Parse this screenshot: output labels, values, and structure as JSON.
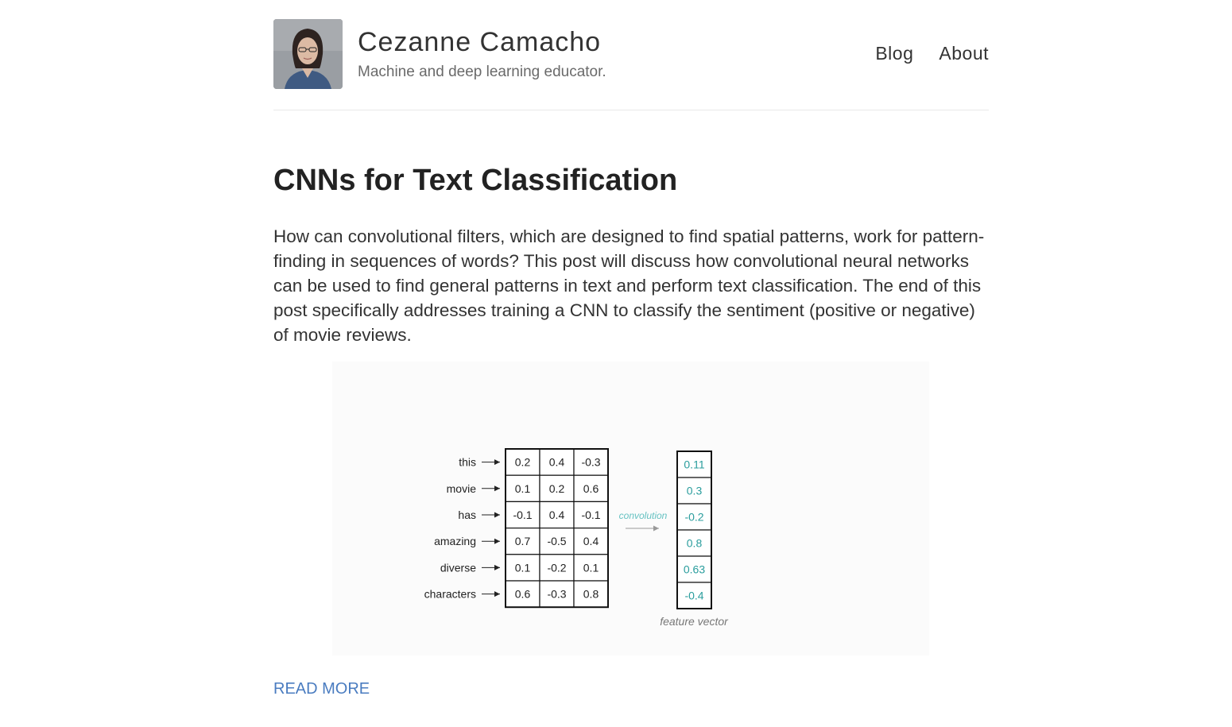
{
  "header": {
    "site_title": "Cezanne Camacho",
    "tagline": "Machine and deep learning educator.",
    "nav": [
      "Blog",
      "About"
    ]
  },
  "post": {
    "title": "CNNs for Text Classification",
    "excerpt": "How can convolutional filters, which are designed to find spatial patterns, work for pattern-finding in sequences of words? This post will discuss how convolutional neural networks can be used to find general patterns in text and perform text classification. The end of this post specifically addresses training a CNN to classify the sentiment (positive or negative) of movie reviews.",
    "read_more": "READ MORE"
  },
  "figure": {
    "words": [
      "this",
      "movie",
      "has",
      "amazing",
      "diverse",
      "characters"
    ],
    "matrix": [
      [
        "0.2",
        "0.4",
        "-0.3"
      ],
      [
        "0.1",
        "0.2",
        "0.6"
      ],
      [
        "-0.1",
        "0.4",
        "-0.1"
      ],
      [
        "0.7",
        "-0.5",
        "0.4"
      ],
      [
        "0.1",
        "-0.2",
        "0.1"
      ],
      [
        "0.6",
        "-0.3",
        "0.8"
      ]
    ],
    "convolution_label": "convolution",
    "feature_vector": [
      "0.11",
      "0.3",
      "-0.2",
      "0.8",
      "0.63",
      "-0.4"
    ],
    "feature_vector_label": "feature vector",
    "accent_color": "#2a9d9d"
  }
}
